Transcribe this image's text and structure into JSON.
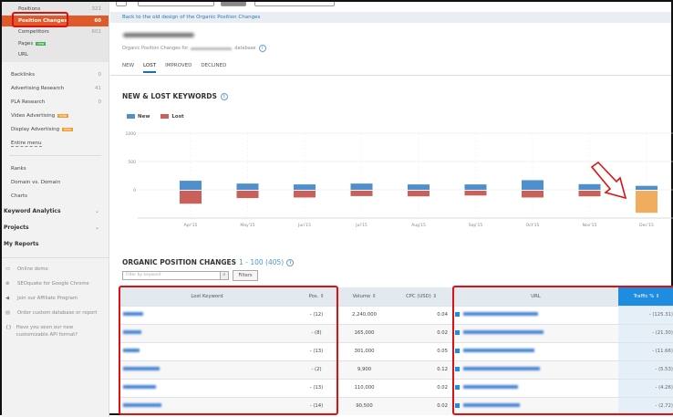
{
  "sidebar": {
    "sub_items": [
      {
        "label": "Positions",
        "count": "321"
      },
      {
        "label": "Position Changes",
        "count": "60",
        "active": true
      },
      {
        "label": "Competitors",
        "count": "601"
      },
      {
        "label": "Pages",
        "badge": "new"
      },
      {
        "label": "URL"
      }
    ],
    "items": [
      {
        "label": "Backlinks",
        "count": "0"
      },
      {
        "label": "Advertising Research",
        "count": "41"
      },
      {
        "label": "PLA Research",
        "count": "0"
      },
      {
        "label": "Video Advertising",
        "badge": "beta"
      },
      {
        "label": "Display Advertising",
        "badge": "beta"
      },
      {
        "label": "Entire menu"
      }
    ],
    "tools": [
      "Ranks",
      "Domain vs. Domain",
      "Charts"
    ],
    "sections": [
      "Keyword Analytics",
      "Projects",
      "My Reports"
    ],
    "footer": [
      {
        "icon": "monitor-icon",
        "label": "Online demo"
      },
      {
        "icon": "seoquake-icon",
        "label": "SEOquake for Google Chrome"
      },
      {
        "icon": "megaphone-icon",
        "label": "Join our Affiliate Program"
      },
      {
        "icon": "database-icon",
        "label": "Order custom database or report"
      },
      {
        "icon": "api-icon",
        "label": "Have you seen our new customizable API format?"
      }
    ]
  },
  "main": {
    "back_link": "Back to the old design of the Organic Position Changes",
    "subtitle_prefix": "Organic Position Changes for",
    "subtitle_suffix": "database",
    "tabs": [
      "NEW",
      "LOST",
      "IMPROVED",
      "DECLINED"
    ],
    "active_tab": "LOST",
    "chart_title": "NEW & LOST KEYWORDS",
    "table_title": "ORGANIC POSITION CHANGES",
    "table_count": "1 - 100 (405)",
    "filter_placeholder": "Filter by keyword",
    "filters_label": "Filters",
    "columns": [
      "Lost Keyword",
      "Pos. ⇕",
      "Volume ⇕",
      "CPC (USD) ⇕",
      "URL",
      "Traffic % ⇕"
    ],
    "rows": [
      {
        "pos": "- (12)",
        "volume": "2,240,000",
        "cpc": "0.04",
        "traffic": "- (125.31)"
      },
      {
        "pos": "- (8)",
        "volume": "165,000",
        "cpc": "0.02",
        "traffic": "- (21.30)"
      },
      {
        "pos": "- (13)",
        "volume": "301,000",
        "cpc": "0.05",
        "traffic": "- (11.66)"
      },
      {
        "pos": "- (2)",
        "volume": "9,900",
        "cpc": "0.12",
        "traffic": "- (5.53)"
      },
      {
        "pos": "- (13)",
        "volume": "110,000",
        "cpc": "0.02",
        "traffic": "- (4.26)"
      },
      {
        "pos": "- (14)",
        "volume": "90,500",
        "cpc": "0.02",
        "traffic": "- (2.72)"
      }
    ]
  },
  "chart_data": {
    "type": "bar",
    "title": "NEW & LOST KEYWORDS",
    "categories": [
      "Apr'15",
      "May'15",
      "Jun'15",
      "Jul'15",
      "Aug'15",
      "Sep'15",
      "Oct'15",
      "Nov'15",
      "Dec'15"
    ],
    "series": [
      {
        "name": "New",
        "color": "#4f8fcc",
        "values": [
          160,
          110,
          95,
          110,
          95,
          95,
          170,
          100,
          70
        ]
      },
      {
        "name": "Lost",
        "color": "#c9605a",
        "values": [
          -230,
          -130,
          -120,
          -95,
          -100,
          -85,
          -120,
          -100,
          -390
        ]
      }
    ],
    "highlight": {
      "category": "Dec'15",
      "color": "#f0ad5e"
    },
    "yticks": [
      1000,
      500,
      0
    ],
    "ylim": [
      -500,
      1000
    ],
    "legend": "top-left",
    "grid": true
  }
}
